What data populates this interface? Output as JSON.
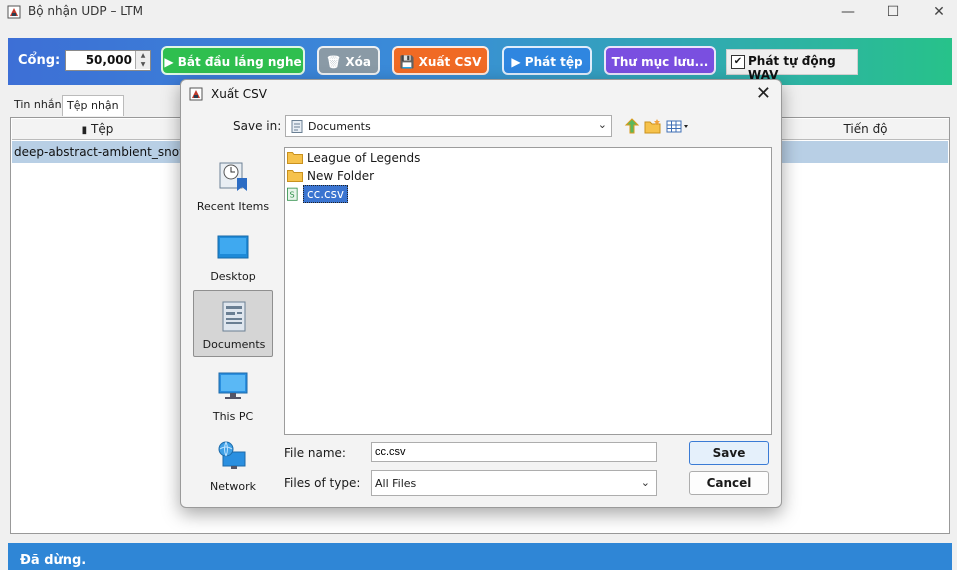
{
  "window": {
    "title": "Bộ nhận UDP – LTM"
  },
  "toolbar": {
    "port_label": "Cổng:",
    "port_value": "50,000",
    "start_label": "▶ Bắt đầu lắng nghe",
    "clear_label": "🗑 Xóa",
    "export_label": "💾 Xuất CSV",
    "play_label": "▶ Phát tệp",
    "folder_label": "Thư mục lưu...",
    "autoplay_checked": "✔",
    "autoplay_label": "Phát tự động WAV",
    "colors": {
      "start": "#2fbf4f",
      "clear": "#8a9aa6",
      "export": "#f06a24",
      "play": "#2f86e0",
      "folder": "#7a4fe0"
    }
  },
  "tabs": [
    {
      "label": "Tin nhắn"
    },
    {
      "label": "Tệp nhận"
    }
  ],
  "table": {
    "columns": [
      "Tệp",
      "Tiến độ"
    ],
    "rows": [
      {
        "file": "deep-abstract-ambient_snowc"
      }
    ]
  },
  "status": {
    "text": "Đã dừng."
  },
  "dialog": {
    "title": "Xuất CSV",
    "save_in_label": "Save in:",
    "save_in_value": "Documents",
    "places": [
      {
        "label": "Recent Items",
        "icon": "recent-items-icon"
      },
      {
        "label": "Desktop",
        "icon": "desktop-icon"
      },
      {
        "label": "Documents",
        "icon": "documents-icon"
      },
      {
        "label": "This PC",
        "icon": "this-pc-icon"
      },
      {
        "label": "Network",
        "icon": "network-icon"
      }
    ],
    "files": [
      {
        "name": "League of Legends",
        "icon": "folder-icon"
      },
      {
        "name": "New Folder",
        "icon": "folder-icon"
      },
      {
        "name": "cc.csv",
        "icon": "csv-file-icon"
      }
    ],
    "file_name_label": "File name:",
    "file_name_value": "cc.csv",
    "file_type_label": "Files of type:",
    "file_type_value": "All Files",
    "save_button": "Save",
    "cancel_button": "Cancel"
  }
}
